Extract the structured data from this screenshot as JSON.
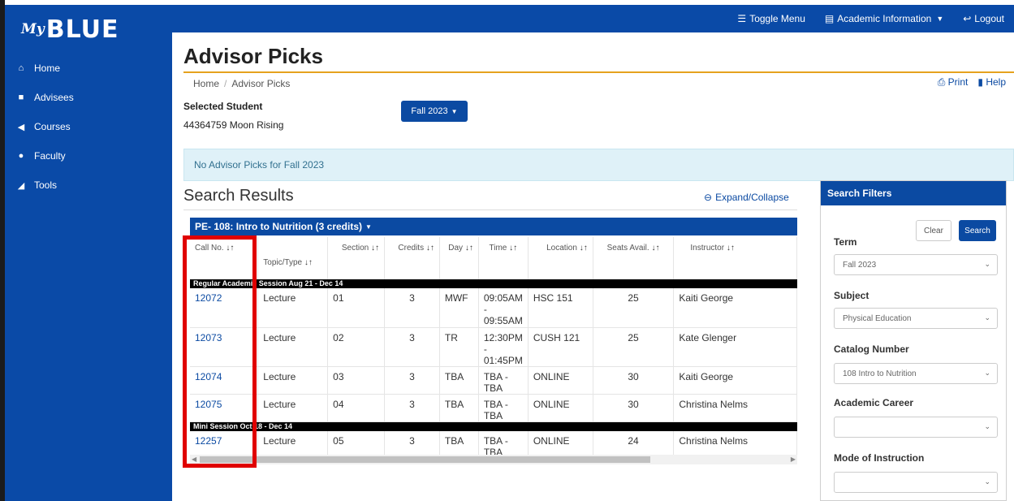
{
  "app": {
    "logo_my": "My",
    "logo_blue": "BLUE"
  },
  "topbar": {
    "toggle_menu": "Toggle Menu",
    "academic_info": "Academic Information",
    "logout": "Logout"
  },
  "sidebar": {
    "items": [
      {
        "label": "Home",
        "icon": "home-icon"
      },
      {
        "label": "Advisees",
        "icon": "folder-icon"
      },
      {
        "label": "Courses",
        "icon": "arrow-left-icon"
      },
      {
        "label": "Faculty",
        "icon": "user-icon"
      },
      {
        "label": "Tools",
        "icon": "tools-icon"
      }
    ]
  },
  "page": {
    "title": "Advisor Picks",
    "breadcrumb_home": "Home",
    "breadcrumb_current": "Advisor Picks",
    "print": "Print",
    "help": "Help",
    "selected_student_label": "Selected Student",
    "selected_student_value": "44364759 Moon  Rising",
    "term_button": "Fall 2023",
    "alert": "No Advisor Picks for Fall 2023",
    "search_results": "Search Results",
    "expand_collapse": "Expand/Collapse"
  },
  "course": {
    "title": "PE- 108: Intro to Nutrition (3 credits)",
    "columns": [
      "Call No.",
      "Topic/Type",
      "Section",
      "Credits",
      "Day",
      "Time",
      "Location",
      "Seats Avail.",
      "Instructor"
    ],
    "sessions": [
      {
        "label": "Regular Academic Session Aug 21 - Dec 14",
        "rows": [
          {
            "call": "12072",
            "type": "Lecture",
            "section": "01",
            "credits": "3",
            "day": "MWF",
            "time_start": "09:05AM -",
            "time_end": "09:55AM",
            "location": "HSC 151",
            "seats": "25",
            "instructor": "Kaiti George"
          },
          {
            "call": "12073",
            "type": "Lecture",
            "section": "02",
            "credits": "3",
            "day": "TR",
            "time_start": "12:30PM -",
            "time_end": "01:45PM",
            "location": "CUSH 121",
            "seats": "25",
            "instructor": "Kate Glenger"
          },
          {
            "call": "12074",
            "type": "Lecture",
            "section": "03",
            "credits": "3",
            "day": "TBA",
            "time_start": "TBA - TBA",
            "time_end": "",
            "location": "ONLINE",
            "seats": "30",
            "instructor": "Kaiti George"
          },
          {
            "call": "12075",
            "type": "Lecture",
            "section": "04",
            "credits": "3",
            "day": "TBA",
            "time_start": "TBA - TBA",
            "time_end": "",
            "location": "ONLINE",
            "seats": "30",
            "instructor": "Christina Nelms"
          }
        ]
      },
      {
        "label": "Mini Session Oct 18 - Dec 14",
        "rows": [
          {
            "call": "12257",
            "type": "Lecture",
            "section": "05",
            "credits": "3",
            "day": "TBA",
            "time_start": "TBA - TBA",
            "time_end": "",
            "location": "ONLINE",
            "seats": "24",
            "instructor": "Christina Nelms"
          }
        ]
      }
    ]
  },
  "filters": {
    "title": "Search Filters",
    "clear": "Clear",
    "search": "Search",
    "term_label": "Term",
    "term_value": "Fall 2023",
    "subject_label": "Subject",
    "subject_value": "Physical Education",
    "catalog_label": "Catalog Number",
    "catalog_value": "108 Intro to Nutrition",
    "career_label": "Academic Career",
    "career_value": "",
    "mode_label": "Mode of Instruction",
    "mode_value": ""
  },
  "colors": {
    "brand_blue": "#0a4aa7",
    "accent_gold": "#e6a21e",
    "highlight_red": "#e00000"
  }
}
